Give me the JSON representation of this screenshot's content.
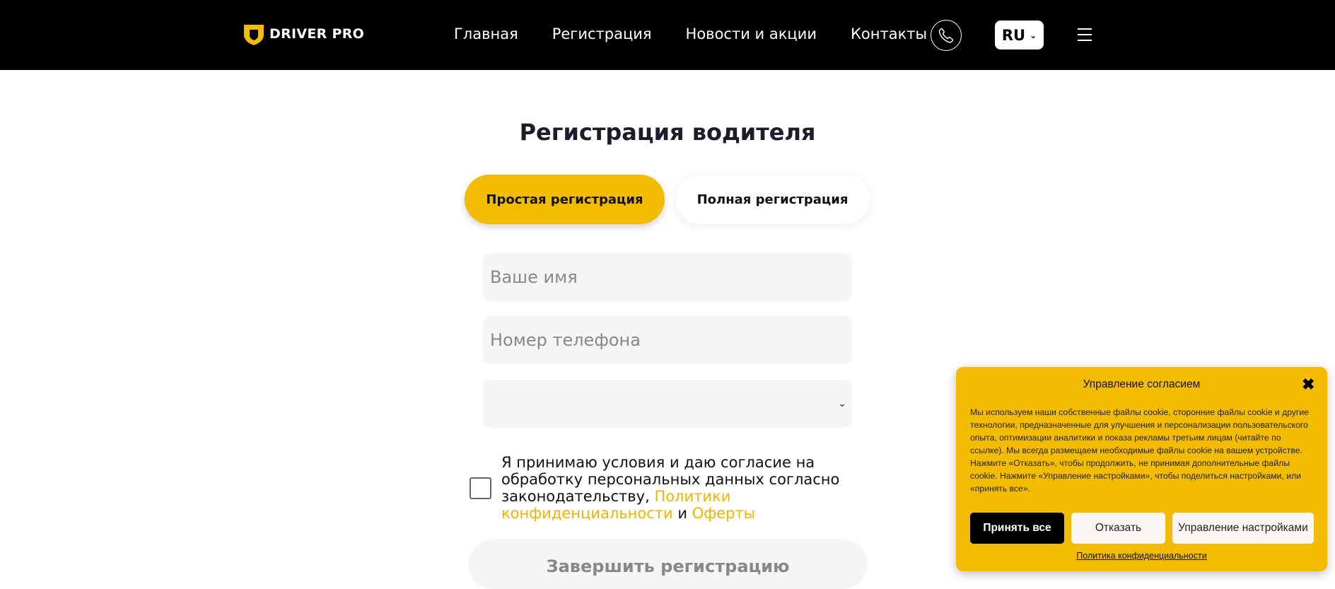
{
  "header": {
    "logo_text": "DRIVER PRO",
    "nav": [
      "Главная",
      "Регистрация",
      "Новости и акции",
      "Контакты"
    ],
    "language": "RU"
  },
  "form": {
    "title": "Регистрация водителя",
    "tabs": {
      "simple": "Простая регистрация",
      "full": "Полная регистрация"
    },
    "name_placeholder": "Ваше имя",
    "phone_placeholder": "Номер телефона",
    "select_value": "",
    "consent": {
      "text": "Я принимаю условия и даю согласие на обработку персональных данных согласно законодательству,",
      "privacy_link": "Политики конфиденциальности",
      "and": "и",
      "offer_link": "Оферты"
    },
    "submit_label": "Завершить регистрацию"
  },
  "cookie": {
    "title": "Управление согласием",
    "body": "Мы используем наши собственные файлы cookie, сторонние файлы cookie и другие технологии, предназначенные для улучшения и персонализации пользовательского опыта, оптимизации аналитики и показа рекламы третьим лицам (читайте по ссылке). Мы всегда размещаем необходимые файлы cookie на вашем устройстве. Нажмите «Отказать», чтобы продолжить, не принимая дополнительные файлы cookie. Нажмите «Управление настройками», чтобы поделиться настройками, или «принять все».",
    "accept_label": "Принять все",
    "deny_label": "Отказать",
    "manage_label": "Управление настройками",
    "policy_link": "Политика конфиденциальности"
  },
  "colors": {
    "accent": "#f4bc00",
    "header_bg": "#000000",
    "field_bg": "#f5f5f5"
  }
}
